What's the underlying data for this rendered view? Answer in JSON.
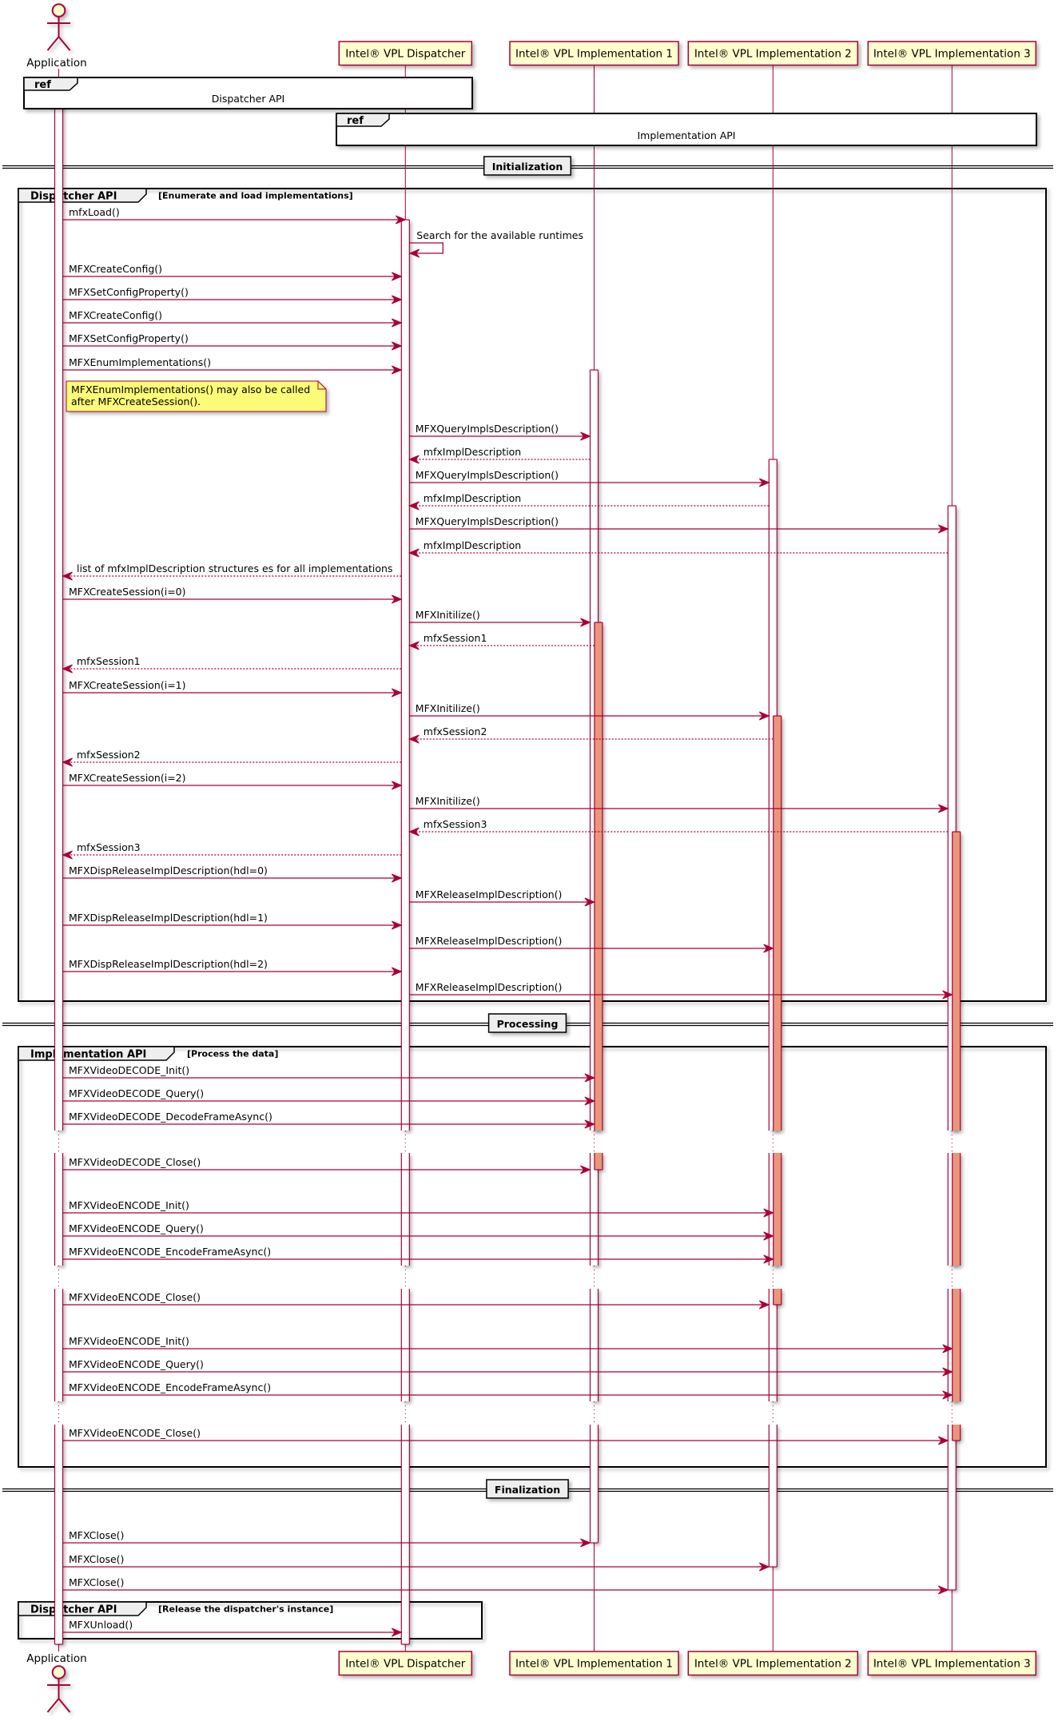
{
  "colors": {
    "line": "#A80036",
    "participant_fill": "#FEFECE",
    "note_fill": "#FBFB77",
    "activation_fill": "#FFFFFF",
    "nested_activation_fill": "#E9967A",
    "frame_tab_fill": "#EEEEEE",
    "frame_border": "#000000",
    "ref_fill": "#FFFFFF"
  },
  "participants": [
    {
      "id": "app",
      "label": "Application",
      "kind": "actor"
    },
    {
      "id": "dispatcher",
      "label": "Intel® VPL Dispatcher",
      "kind": "participant"
    },
    {
      "id": "impl1",
      "label": "Intel® VPL Implementation 1",
      "kind": "participant"
    },
    {
      "id": "impl2",
      "label": "Intel® VPL Implementation 2",
      "kind": "participant"
    },
    {
      "id": "impl3",
      "label": "Intel® VPL Implementation 3",
      "kind": "participant"
    }
  ],
  "refs": [
    {
      "tag": "ref",
      "label": "Dispatcher API",
      "over": [
        "app",
        "dispatcher"
      ]
    },
    {
      "tag": "ref",
      "label": "Implementation API",
      "over": [
        "dispatcher",
        "impl3"
      ]
    }
  ],
  "sections": [
    {
      "label": "Initialization"
    },
    {
      "label": "Processing"
    },
    {
      "label": "Finalization"
    }
  ],
  "groups": [
    {
      "label": "Dispatcher API",
      "guard": "[Enumerate and load implementations]"
    },
    {
      "label": "Implementation API",
      "guard": "[Process the data]"
    },
    {
      "label": "Dispatcher API",
      "guard": "[Release the dispatcher's instance]"
    }
  ],
  "note": {
    "lines": [
      "MFXEnumImplementations() may also be called",
      "after MFXCreateSession()."
    ]
  },
  "messages": [
    {
      "from": "app",
      "to": "dispatcher",
      "label": "mfxLoad()",
      "kind": "sync"
    },
    {
      "from": "dispatcher",
      "to": "dispatcher",
      "label": "Search for the available runtimes",
      "kind": "self"
    },
    {
      "from": "app",
      "to": "dispatcher",
      "label": "MFXCreateConfig()",
      "kind": "sync"
    },
    {
      "from": "app",
      "to": "dispatcher",
      "label": "MFXSetConfigProperty()",
      "kind": "sync"
    },
    {
      "from": "app",
      "to": "dispatcher",
      "label": "MFXCreateConfig()",
      "kind": "sync"
    },
    {
      "from": "app",
      "to": "dispatcher",
      "label": "MFXSetConfigProperty()",
      "kind": "sync"
    },
    {
      "from": "app",
      "to": "dispatcher",
      "label": "MFXEnumImplementations()",
      "kind": "sync"
    },
    {
      "from": "dispatcher",
      "to": "impl1",
      "label": "MFXQueryImplsDescription()",
      "kind": "sync"
    },
    {
      "from": "impl1",
      "to": "dispatcher",
      "label": "mfxImplDescription",
      "kind": "return"
    },
    {
      "from": "dispatcher",
      "to": "impl2",
      "label": "MFXQueryImplsDescription()",
      "kind": "sync"
    },
    {
      "from": "impl2",
      "to": "dispatcher",
      "label": "mfxImplDescription",
      "kind": "return"
    },
    {
      "from": "dispatcher",
      "to": "impl3",
      "label": "MFXQueryImplsDescription()",
      "kind": "sync"
    },
    {
      "from": "impl3",
      "to": "dispatcher",
      "label": "mfxImplDescription",
      "kind": "return"
    },
    {
      "from": "dispatcher",
      "to": "app",
      "label": "list of mfxImplDescription structures es for all implementations",
      "kind": "return"
    },
    {
      "from": "app",
      "to": "dispatcher",
      "label": "MFXCreateSession(i=0)",
      "kind": "sync"
    },
    {
      "from": "dispatcher",
      "to": "impl1",
      "label": "MFXInitilize()",
      "kind": "sync"
    },
    {
      "from": "impl1",
      "to": "dispatcher",
      "label": "mfxSession1",
      "kind": "return"
    },
    {
      "from": "dispatcher",
      "to": "app",
      "label": "mfxSession1",
      "kind": "return"
    },
    {
      "from": "app",
      "to": "dispatcher",
      "label": "MFXCreateSession(i=1)",
      "kind": "sync"
    },
    {
      "from": "dispatcher",
      "to": "impl2",
      "label": "MFXInitilize()",
      "kind": "sync"
    },
    {
      "from": "impl2",
      "to": "dispatcher",
      "label": "mfxSession2",
      "kind": "return"
    },
    {
      "from": "dispatcher",
      "to": "app",
      "label": "mfxSession2",
      "kind": "return"
    },
    {
      "from": "app",
      "to": "dispatcher",
      "label": "MFXCreateSession(i=2)",
      "kind": "sync"
    },
    {
      "from": "dispatcher",
      "to": "impl3",
      "label": "MFXInitilize()",
      "kind": "sync"
    },
    {
      "from": "impl3",
      "to": "dispatcher",
      "label": "mfxSession3",
      "kind": "return"
    },
    {
      "from": "dispatcher",
      "to": "app",
      "label": "mfxSession3",
      "kind": "return"
    },
    {
      "from": "app",
      "to": "dispatcher",
      "label": "MFXDispReleaseImplDescription(hdl=0)",
      "kind": "sync"
    },
    {
      "from": "dispatcher",
      "to": "impl1",
      "label": "MFXReleaseImplDescription()",
      "kind": "sync"
    },
    {
      "from": "app",
      "to": "dispatcher",
      "label": "MFXDispReleaseImplDescription(hdl=1)",
      "kind": "sync"
    },
    {
      "from": "dispatcher",
      "to": "impl2",
      "label": "MFXReleaseImplDescription()",
      "kind": "sync"
    },
    {
      "from": "app",
      "to": "dispatcher",
      "label": "MFXDispReleaseImplDescription(hdl=2)",
      "kind": "sync"
    },
    {
      "from": "dispatcher",
      "to": "impl3",
      "label": "MFXReleaseImplDescription()",
      "kind": "sync"
    },
    {
      "from": "app",
      "to": "impl1",
      "label": "MFXVideoDECODE_Init()",
      "kind": "sync"
    },
    {
      "from": "app",
      "to": "impl1",
      "label": "MFXVideoDECODE_Query()",
      "kind": "sync"
    },
    {
      "from": "app",
      "to": "impl1",
      "label": "MFXVideoDECODE_DecodeFrameAsync()",
      "kind": "sync"
    },
    {
      "from": "app",
      "to": "impl1",
      "label": "MFXVideoDECODE_Close()",
      "kind": "sync"
    },
    {
      "from": "app",
      "to": "impl2",
      "label": "MFXVideoENCODE_Init()",
      "kind": "sync"
    },
    {
      "from": "app",
      "to": "impl2",
      "label": "MFXVideoENCODE_Query()",
      "kind": "sync"
    },
    {
      "from": "app",
      "to": "impl2",
      "label": "MFXVideoENCODE_EncodeFrameAsync()",
      "kind": "sync"
    },
    {
      "from": "app",
      "to": "impl2",
      "label": "MFXVideoENCODE_Close()",
      "kind": "sync"
    },
    {
      "from": "app",
      "to": "impl3",
      "label": "MFXVideoENCODE_Init()",
      "kind": "sync"
    },
    {
      "from": "app",
      "to": "impl3",
      "label": "MFXVideoENCODE_Query()",
      "kind": "sync"
    },
    {
      "from": "app",
      "to": "impl3",
      "label": "MFXVideoENCODE_EncodeFrameAsync()",
      "kind": "sync"
    },
    {
      "from": "app",
      "to": "impl3",
      "label": "MFXVideoENCODE_Close()",
      "kind": "sync"
    },
    {
      "from": "app",
      "to": "impl1",
      "label": "MFXClose()",
      "kind": "sync"
    },
    {
      "from": "app",
      "to": "impl2",
      "label": "MFXClose()",
      "kind": "sync"
    },
    {
      "from": "app",
      "to": "impl3",
      "label": "MFXClose()",
      "kind": "sync"
    },
    {
      "from": "app",
      "to": "dispatcher",
      "label": "MFXUnload()",
      "kind": "sync"
    }
  ]
}
